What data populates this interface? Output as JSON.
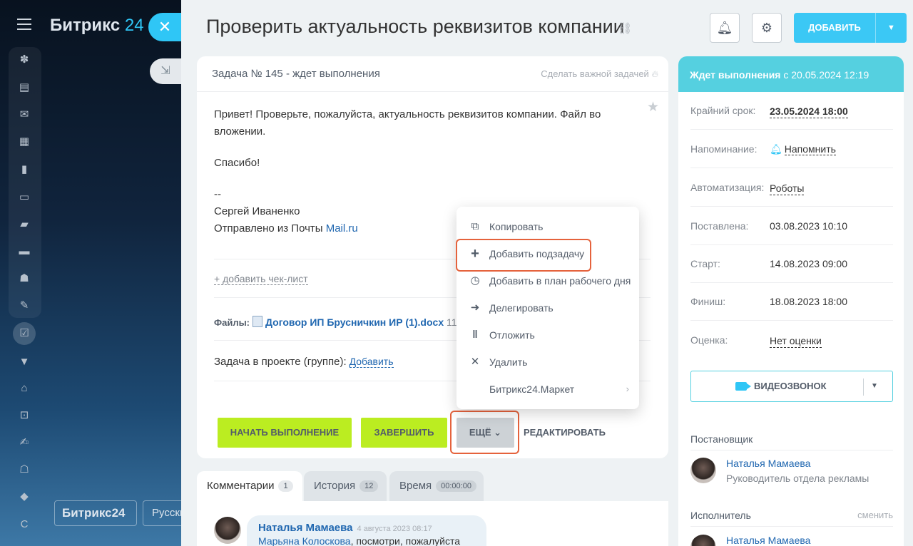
{
  "app": {
    "logo_main": "Битрикс",
    "logo_num": "24",
    "bottom_badge": "Битрикс24",
    "bottom_lang": "Русский"
  },
  "header": {
    "title": "Проверить актуальность реквизитов компании",
    "add_label": "ДОБАВИТЬ"
  },
  "task": {
    "head_title": "Задача № 145 - ждет выполнения",
    "make_important": "Сделать важной задачей",
    "desc_line1": "Привет! Проверьте, пожалуйста, актуальность реквизитов компании. Файл во вложении.",
    "desc_thanks": "Спасибо!",
    "desc_sep": "--",
    "desc_sig_name": "Сергей Иваненко",
    "desc_sent_from": "Отправлено из Почты",
    "desc_mail_link": "Mail.ru",
    "add_checklist": "+ добавить чек-лист",
    "files_label": "Файлы:",
    "file_name": "Договор ИП Брусничкин ИР (1).docx",
    "file_size": "11",
    "project_label": "Задача в проекте (группе):",
    "project_add": "Добавить"
  },
  "actions": {
    "start": "НАЧАТЬ ВЫПОЛНЕНИЕ",
    "complete": "ЗАВЕРШИТЬ",
    "more": "ЕЩЁ",
    "edit": "РЕДАКТИРОВАТЬ"
  },
  "menu": {
    "items": [
      {
        "label": "Копировать",
        "icon": "copy-icon"
      },
      {
        "label": "Добавить подзадачу",
        "icon": "plus-icon"
      },
      {
        "label": "Добавить в план рабочего дня",
        "icon": "clock-icon"
      },
      {
        "label": "Делегировать",
        "icon": "delegate-icon"
      },
      {
        "label": "Отложить",
        "icon": "pause-icon"
      },
      {
        "label": "Удалить",
        "icon": "delete-icon"
      },
      {
        "label": "Битрикс24.Маркет",
        "icon": "market-icon"
      }
    ]
  },
  "tabs": [
    {
      "label": "Комментарии",
      "count": "1"
    },
    {
      "label": "История",
      "count": "12"
    },
    {
      "label": "Время",
      "count": "00:00:00"
    }
  ],
  "comment": {
    "author": "Наталья Мамаева",
    "date": "4 августа 2023 08:17",
    "mention": "Марьяна Колоскова",
    "text": ", посмотри, пожалуйста"
  },
  "side": {
    "status_bold": "Ждет выполнения",
    "status_rest": " с 20.05.2024 12:19",
    "deadline_k": "Крайний срок:",
    "deadline_v": "23.05.2024 18:00",
    "remind_k": "Напоминание:",
    "remind_v": "Напомнить",
    "auto_k": "Автоматизация:",
    "auto_v": "Роботы",
    "created_k": "Поставлена:",
    "created_v": "03.08.2023 10:10",
    "start_k": "Старт:",
    "start_v": "14.08.2023 09:00",
    "finish_k": "Финиш:",
    "finish_v": "18.08.2023 18:00",
    "rating_k": "Оценка:",
    "rating_v": "Нет оценки",
    "video": "ВИДЕОЗВОНОК",
    "creator_title": "Постановщик",
    "creator_name": "Наталья Мамаева",
    "creator_pos": "Руководитель отдела рекламы",
    "assignee_title": "Исполнитель",
    "assignee_change": "сменить",
    "assignee_name": "Наталья Мамаева"
  },
  "colors": {
    "accent": "#2fc6f6",
    "status_bar": "#55d0e0",
    "green_button": "#bbed21",
    "highlight": "#e5623c"
  }
}
